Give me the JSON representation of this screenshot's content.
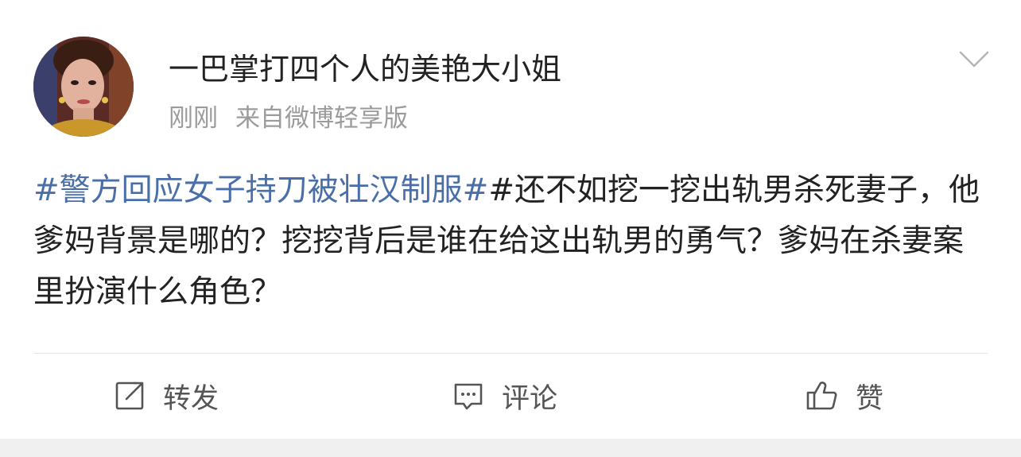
{
  "post": {
    "username": "一巴掌打四个人的美艳大小姐",
    "time": "刚刚",
    "source": "来自微博轻享版",
    "hashtag1": "#警方回应女子持刀被壮汉制服#",
    "hashtag2": "#",
    "body": "还不如挖一挖出轨男杀死妻子，他爹妈背景是哪的？挖挖背后是谁在给这出轨男的勇气？爹妈在杀妻案里扮演什么角色？"
  },
  "actions": {
    "repost_label": "转发",
    "comment_label": "评论",
    "like_label": "赞"
  },
  "icons": {
    "avatar": "avatar-photo",
    "more": "chevron-down-icon",
    "repost": "repost-icon",
    "comment": "comment-icon",
    "like": "thumbs-up-icon"
  },
  "colors": {
    "hashtag": "#4a6fa8",
    "text": "#222222",
    "meta": "#9b9b9b",
    "action": "#555555"
  }
}
